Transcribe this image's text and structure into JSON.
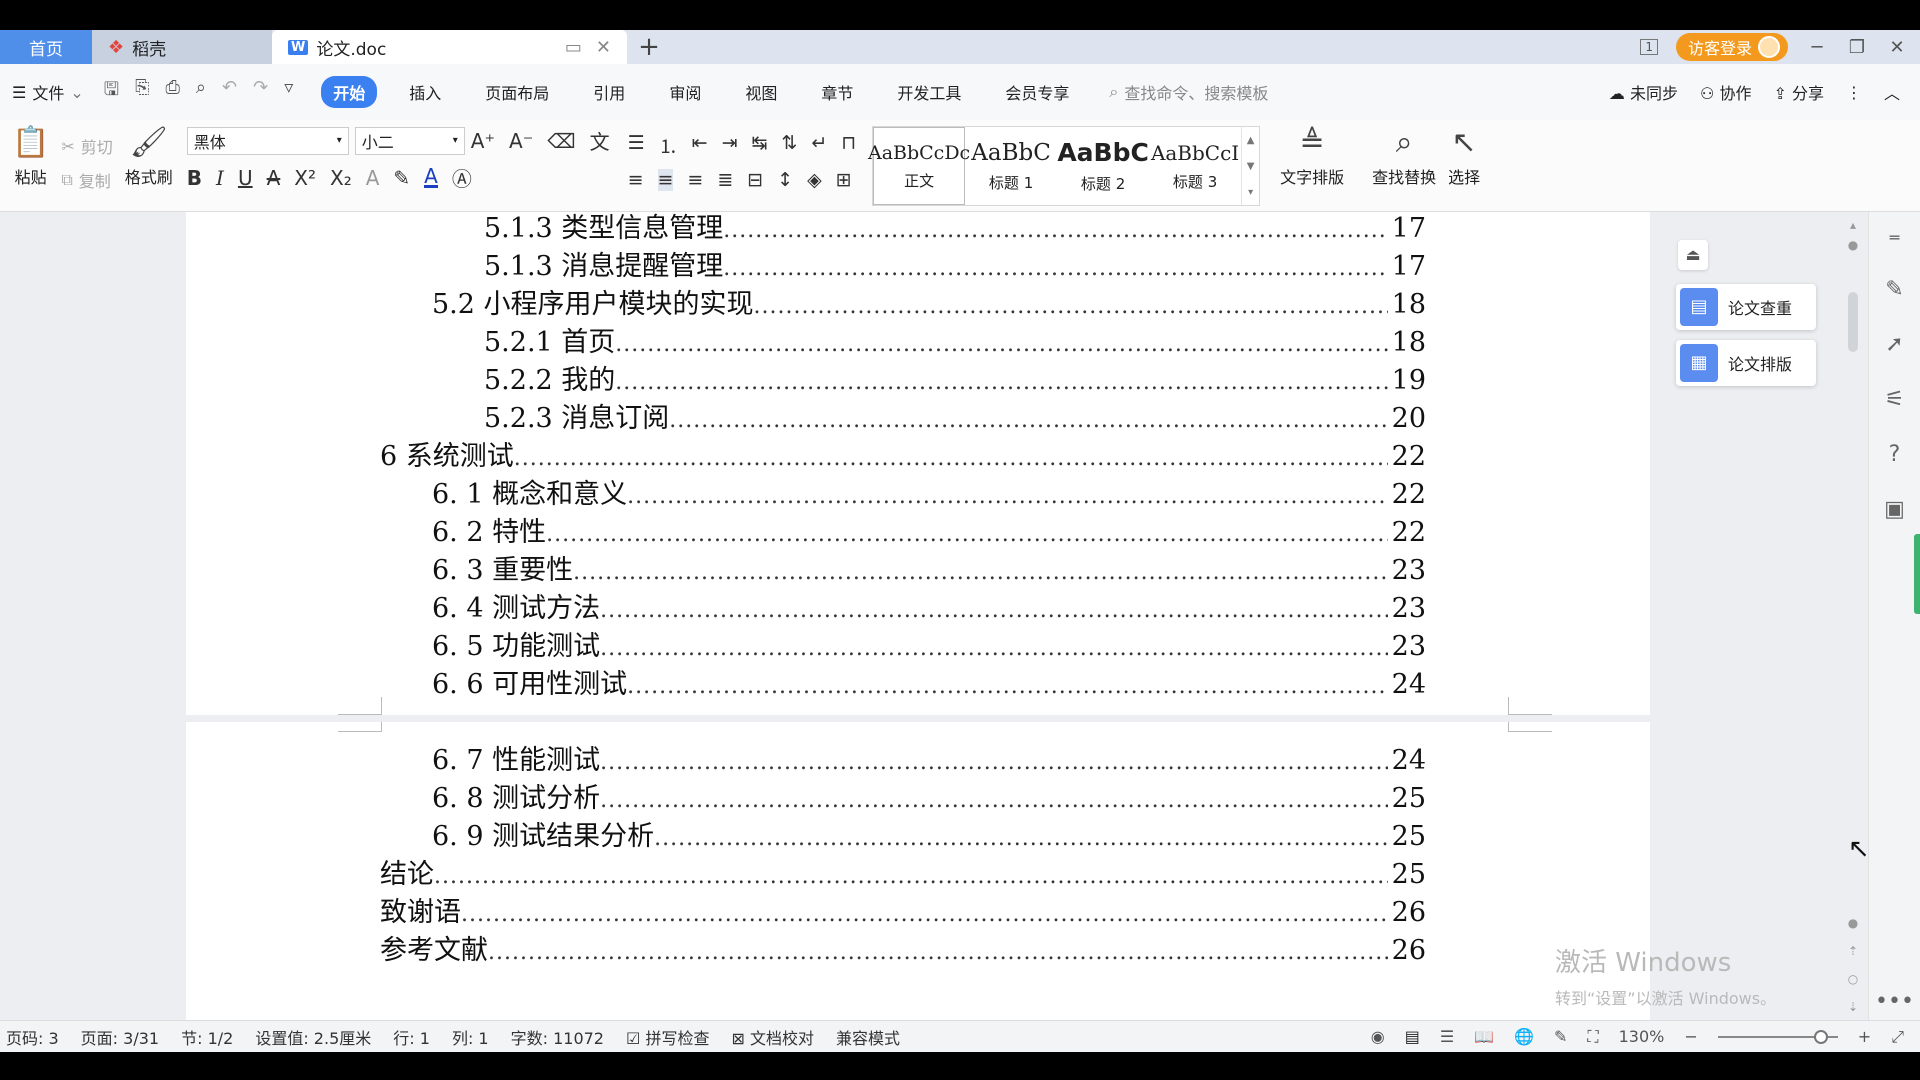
{
  "tabs": {
    "home": "首页",
    "daoke": "稻壳",
    "doc": "论文.doc",
    "new_tab": "+",
    "guest_login": "访客登录"
  },
  "menu": {
    "file": "文件",
    "tabs": [
      "开始",
      "插入",
      "页面布局",
      "引用",
      "审阅",
      "视图",
      "章节",
      "开发工具",
      "会员专享"
    ],
    "active_tab": "开始",
    "search_placeholder": "查找命令、搜索模板",
    "unsynced": "未同步",
    "collaborate": "协作",
    "share": "分享"
  },
  "ribbon": {
    "paste": "粘贴",
    "cut": "剪切",
    "copy": "复制",
    "format_painter": "格式刷",
    "font_name": "黑体",
    "font_size": "小二",
    "styles": [
      {
        "preview": "AaBbCcDc",
        "name": "正文"
      },
      {
        "preview": "AaBbC",
        "name": "标题 1"
      },
      {
        "preview": "AaBbC",
        "name": "标题 2"
      },
      {
        "preview": "AaBbCcI",
        "name": "标题 3"
      }
    ],
    "text_layout": "文字排版",
    "find_replace": "查找替换",
    "select": "选择"
  },
  "toc": [
    {
      "level": 3,
      "title": "5.1.3  类型信息管理",
      "page": "17"
    },
    {
      "level": 3,
      "title": "5.1.3  消息提醒管理",
      "page": "17"
    },
    {
      "level": 2,
      "title": "5.2  小程序用户模块的实现",
      "page": "18"
    },
    {
      "level": 3,
      "title": "5.2.1  首页",
      "page": "18"
    },
    {
      "level": 3,
      "title": "5.2.2  我的",
      "page": "19"
    },
    {
      "level": 3,
      "title": "5.2.3  消息订阅",
      "page": "20"
    },
    {
      "level": 1,
      "title": "6 系统测试",
      "page": "22"
    },
    {
      "level": 2,
      "title": "6. 1 概念和意义",
      "page": "22"
    },
    {
      "level": 2,
      "title": "6. 2 特性",
      "page": "22"
    },
    {
      "level": 2,
      "title": "6. 3 重要性",
      "page": "23"
    },
    {
      "level": 2,
      "title": "6. 4 测试方法",
      "page": "23"
    },
    {
      "level": 2,
      "title": "6. 5  功能测试",
      "page": "23"
    },
    {
      "level": 2,
      "title": "6. 6 可用性测试",
      "page": "24"
    },
    {
      "level": 2,
      "title": "6. 7 性能测试",
      "page": "24"
    },
    {
      "level": 2,
      "title": "6. 8 测试分析",
      "page": "25"
    },
    {
      "level": 2,
      "title": "6. 9 测试结果分析",
      "page": "25"
    },
    {
      "level": 1,
      "title": "结论",
      "page": "25"
    },
    {
      "level": 1,
      "title": "致谢语",
      "page": "26"
    },
    {
      "level": 1,
      "title": "参考文献",
      "page": "26"
    }
  ],
  "side_panel": {
    "plagiarism_check": "论文查重",
    "thesis_layout": "论文排版"
  },
  "watermark": {
    "line1": "激活 Windows",
    "line2": "转到“设置”以激活 Windows。"
  },
  "status": {
    "page_code": "页码: 3",
    "page": "页面: 3/31",
    "section": "节: 1/2",
    "setting": "设置值: 2.5厘米",
    "row": "行: 1",
    "col": "列: 1",
    "word_count": "字数: 11072",
    "spell_check": "拼写检查",
    "doc_proof": "文档校对",
    "compat_mode": "兼容模式",
    "zoom": "130%"
  },
  "colors": {
    "accent": "#3a80f0",
    "home_tab": "#4f8fea",
    "guest_login": "#f39a1e"
  }
}
